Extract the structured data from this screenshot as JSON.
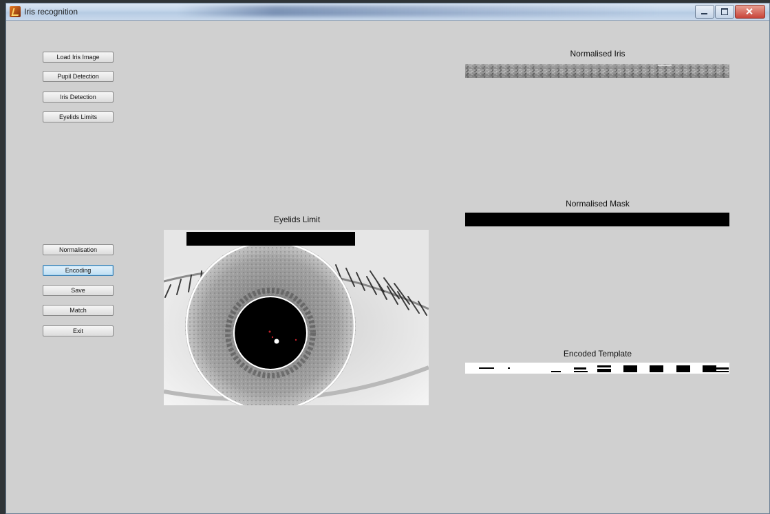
{
  "window": {
    "title": "Iris recognition"
  },
  "buttons": {
    "load": "Load Iris Image",
    "pupil": "Pupil Detection",
    "iris": "Iris Detection",
    "eyelids": "Eyelids Limits",
    "normalisation": "Normalisation",
    "encoding": "Encoding",
    "save": "Save",
    "match": "Match",
    "exit": "Exit"
  },
  "panels": {
    "eyelids_title": "Eyelids Limit",
    "normalised_iris_title": "Normalised Iris",
    "normalised_mask_title": "Normalised Mask",
    "encoded_template_title": "Encoded Template"
  },
  "state": {
    "active_button": "Encoding"
  },
  "colors": {
    "background": "#d0d0d0",
    "button_active_border": "#3c7fb1",
    "mask": "#000000"
  },
  "icons": [
    "matlab-icon",
    "minimize-icon",
    "maximize-icon",
    "close-icon"
  ]
}
